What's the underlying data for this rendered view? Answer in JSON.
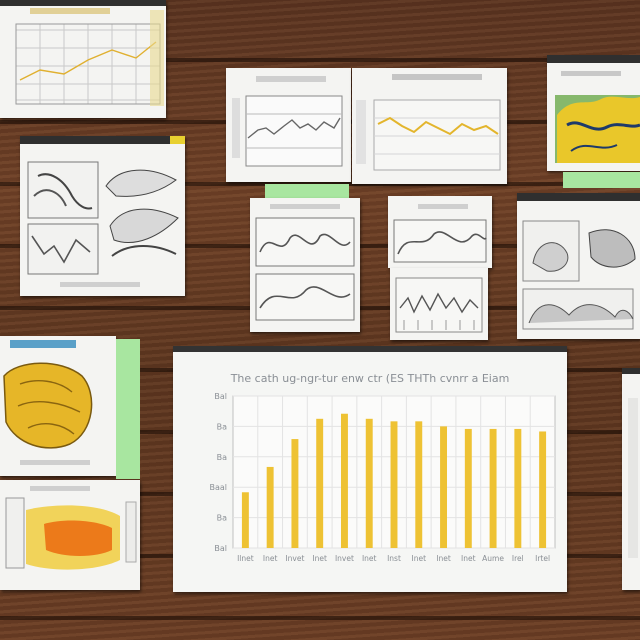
{
  "scene": {
    "description_colors": {
      "wood_dark": "#4a2a18",
      "wood_light": "#7a4a2c",
      "paper": "#f4f4f2",
      "bar_yellow": "#eec233",
      "tab_green": "#a8e6a0"
    }
  },
  "main_chart": {
    "title": "The cath ug-ngr-tur enw ctr (ES THTh cvnrr a Eiam",
    "ylabel": "",
    "xlabel": "",
    "ytick_labels": [
      "Bal",
      "Ba",
      "Ba",
      "Baal",
      "Ba",
      "Bal"
    ],
    "chart_data": {
      "type": "bar",
      "categories": [
        "Ilnet",
        "Inet",
        "Invet",
        "Inet",
        "Invet",
        "Inet",
        "Inst",
        "Inet",
        "Inet",
        "Inet",
        "Aume",
        "Irel",
        "Irtel"
      ],
      "values": [
        22,
        32,
        43,
        51,
        53,
        51,
        50,
        50,
        48,
        47,
        47,
        47,
        46
      ],
      "ylim": [
        0,
        60
      ],
      "grid": true,
      "color": "#eec233"
    }
  },
  "sheets": {
    "top_left_label": "",
    "mid_left_caption": ""
  }
}
